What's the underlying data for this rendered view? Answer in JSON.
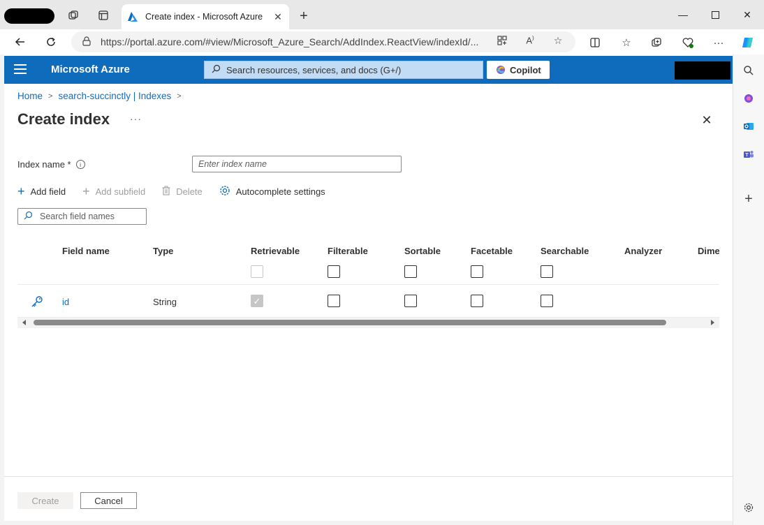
{
  "browser": {
    "tab_title": "Create index - Microsoft Azure",
    "url": "https://portal.azure.com/#view/Microsoft_Azure_Search/AddIndex.ReactView/indexId/...",
    "icons": [
      "workspaces-icon",
      "tab-actions-icon",
      "close-icon",
      "new-tab-icon",
      "minimize-icon",
      "maximize-icon",
      "close-window-icon",
      "back-icon",
      "refresh-icon",
      "lock-icon",
      "apps-icon",
      "read-aloud-icon",
      "favorite-star-icon",
      "split-screen-icon",
      "favorites-icon",
      "collections-icon",
      "browser-essentials-icon",
      "more-icon",
      "copilot-icon"
    ]
  },
  "edge_sidebar": {
    "icons": [
      "search-icon",
      "copilot-app-icon",
      "outlook-icon",
      "teams-icon",
      "add-icon",
      "settings-icon"
    ]
  },
  "portal": {
    "brand": "Microsoft Azure",
    "search_placeholder": "Search resources, services, and docs (G+/)",
    "copilot_label": "Copilot",
    "breadcrumb": [
      {
        "label": "Home"
      },
      {
        "label": "search-succinctly | Indexes"
      }
    ],
    "page_title": "Create index",
    "more_label": "···",
    "index_name_label": "Index name *",
    "index_name_placeholder": "Enter index name",
    "commands": [
      {
        "label": "Add field",
        "enabled": true,
        "icon": "plus-icon"
      },
      {
        "label": "Add subfield",
        "enabled": false,
        "icon": "plus-icon"
      },
      {
        "label": "Delete",
        "enabled": false,
        "icon": "trash-icon"
      },
      {
        "label": "Autocomplete settings",
        "enabled": true,
        "icon": "gear-icon"
      }
    ],
    "field_search_placeholder": "Search field names",
    "columns": [
      "Field name",
      "Type",
      "Retrievable",
      "Filterable",
      "Sortable",
      "Facetable",
      "Searchable",
      "Analyzer",
      "Dime"
    ],
    "rows": [
      {
        "field_name": "id",
        "type": "String",
        "retrievable": true,
        "filterable": false,
        "sortable": false,
        "facetable": false,
        "searchable": false,
        "key": true
      }
    ],
    "footer": {
      "create_label": "Create",
      "cancel_label": "Cancel"
    },
    "colors": {
      "header_blue": "#0f6cbd",
      "link_blue": "#0f6cbd"
    }
  }
}
